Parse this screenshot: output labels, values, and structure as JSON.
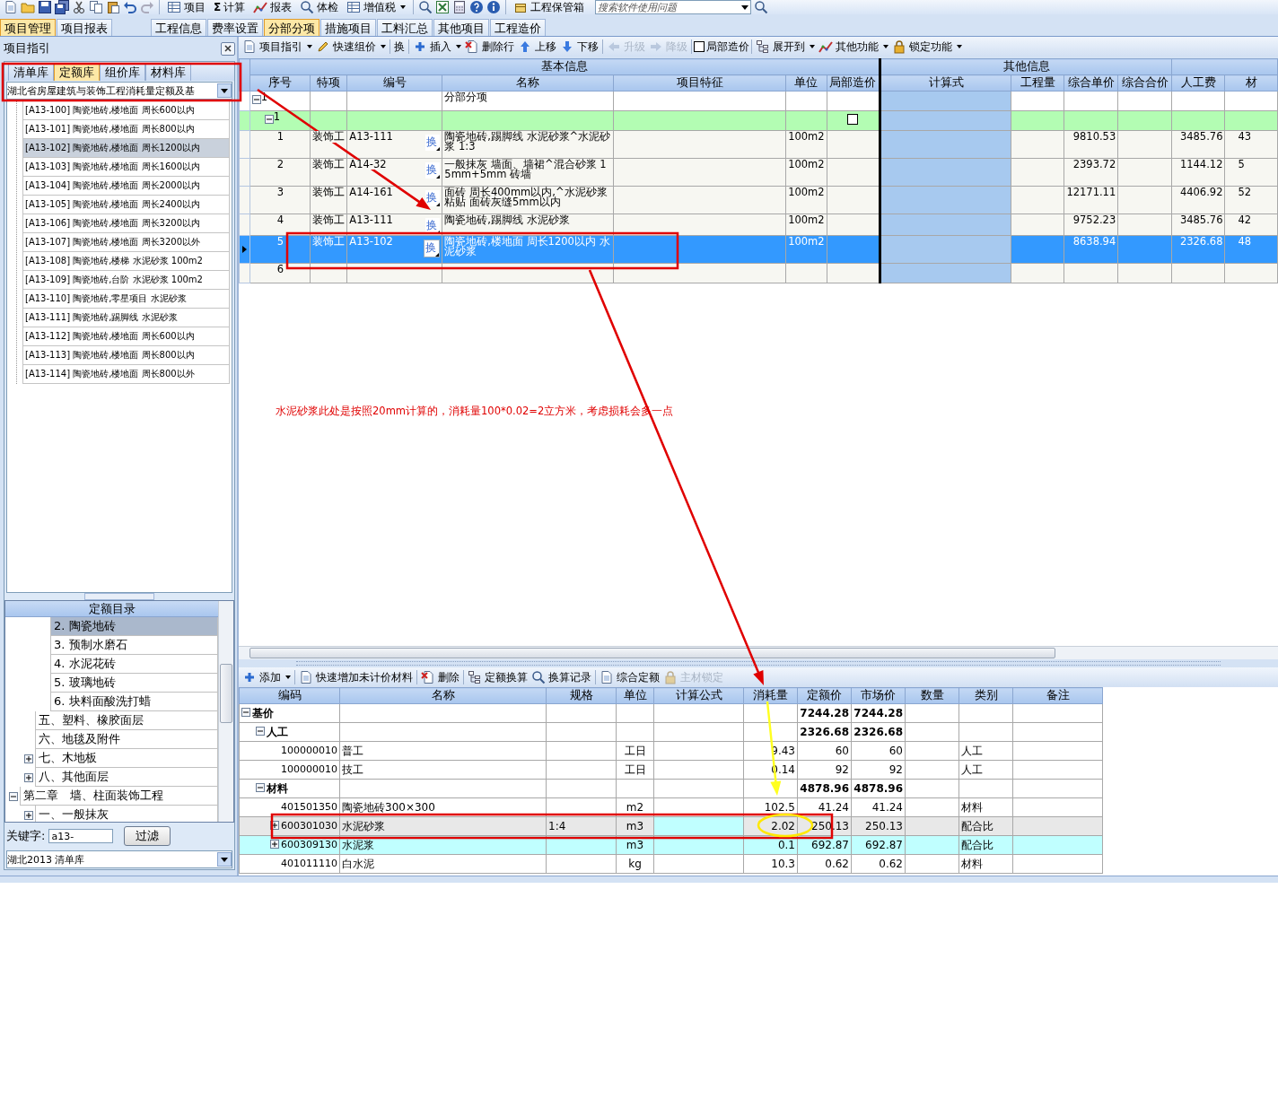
{
  "toolbar_top": {
    "commands": [
      {
        "label": "项目"
      },
      {
        "glyph": "Σ",
        "label": "计算"
      },
      {
        "label": "报表"
      },
      {
        "label": "体检"
      },
      {
        "label": "增值税",
        "dropdown": true
      }
    ],
    "storage": {
      "label": "工程保管箱"
    }
  },
  "search": {
    "placeholder": "搜索软件使用问题"
  },
  "app_tabs": [
    {
      "label": "项目管理",
      "selected": true
    },
    {
      "label": "项目报表",
      "selected": false
    }
  ],
  "view_tabs": [
    {
      "label": "工程信息",
      "selected": false
    },
    {
      "label": "费率设置",
      "selected": false
    },
    {
      "label": "分部分项",
      "selected": true
    },
    {
      "label": "措施项目",
      "selected": false
    },
    {
      "label": "工料汇总",
      "selected": false
    },
    {
      "label": "其他项目",
      "selected": false
    },
    {
      "label": "工程造价",
      "selected": false
    }
  ],
  "side_panel": {
    "title": "项目指引",
    "tabs": [
      {
        "label": "清单库",
        "selected": false
      },
      {
        "label": "定额库",
        "selected": true
      },
      {
        "label": "组价库",
        "selected": false
      },
      {
        "label": "材料库",
        "selected": false
      }
    ],
    "library": "湖北省房屋建筑与装饰工程消耗量定额及基",
    "items": [
      {
        "label": "[A13-100] 陶瓷地砖,楼地面 周长600以内",
        "selected": false
      },
      {
        "label": "[A13-101] 陶瓷地砖,楼地面 周长800以内",
        "selected": false
      },
      {
        "label": "[A13-102] 陶瓷地砖,楼地面 周长1200以内",
        "selected": true
      },
      {
        "label": "[A13-103] 陶瓷地砖,楼地面 周长1600以内",
        "selected": false
      },
      {
        "label": "[A13-104] 陶瓷地砖,楼地面 周长2000以内",
        "selected": false
      },
      {
        "label": "[A13-105] 陶瓷地砖,楼地面 周长2400以内",
        "selected": false
      },
      {
        "label": "[A13-106] 陶瓷地砖,楼地面 周长3200以内",
        "selected": false
      },
      {
        "label": "[A13-107] 陶瓷地砖,楼地面 周长3200以外",
        "selected": false
      },
      {
        "label": "[A13-108] 陶瓷地砖,楼梯 水泥砂浆 100m2",
        "selected": false
      },
      {
        "label": "[A13-109] 陶瓷地砖,台阶 水泥砂浆 100m2",
        "selected": false
      },
      {
        "label": "[A13-110] 陶瓷地砖,零星项目 水泥砂浆",
        "selected": false
      },
      {
        "label": "[A13-111] 陶瓷地砖,踢脚线 水泥砂浆",
        "selected": false
      },
      {
        "label": "[A13-112] 陶瓷地砖,楼地面 周长600以内",
        "selected": false
      },
      {
        "label": "[A13-113] 陶瓷地砖,楼地面 周长800以内",
        "selected": false
      },
      {
        "label": "[A13-114] 陶瓷地砖,楼地面 周长800以外",
        "selected": false
      }
    ],
    "catalog": {
      "title": "定额目录",
      "tree": [
        {
          "children": [
            {
              "children": [
                {
                  "label": "2. 陶瓷地砖",
                  "selected": true
                },
                {
                  "label": "3. 预制水磨石",
                  "selected": false
                },
                {
                  "label": "4. 水泥花砖",
                  "selected": false
                },
                {
                  "label": "5. 玻璃地砖",
                  "selected": false
                },
                {
                  "label": "6. 块料面酸洗打蜡",
                  "selected": false
                }
              ]
            },
            {
              "label": "五、塑料、橡胶面层",
              "selected": false
            },
            {
              "label": "六、地毯及附件",
              "selected": false
            },
            {
              "label": "七、木地板",
              "expanded": false,
              "selected": false
            },
            {
              "label": "八、其他面层",
              "expanded": false,
              "selected": false
            }
          ]
        },
        {
          "label": "第二章　墙、柱面装饰工程",
          "expanded": true,
          "selected": false,
          "children": [
            {
              "label": "一、一般抹灰",
              "expanded": false,
              "selected": false
            }
          ]
        }
      ]
    },
    "keyword": {
      "label": "关键字:",
      "value": "a13-"
    },
    "filter_button": "过滤",
    "bottom_library": "湖北2013 清单库"
  },
  "toolbar_main": [
    {
      "kind": "button",
      "label": "项目指引",
      "dropdown": true
    },
    {
      "kind": "button",
      "label": "快速组价",
      "dropdown": true
    },
    {
      "kind": "separator"
    },
    {
      "kind": "text",
      "label": "换"
    },
    {
      "kind": "separator"
    },
    {
      "kind": "button",
      "label": "插入",
      "dropdown": true
    },
    {
      "kind": "button",
      "label": "删除行"
    },
    {
      "kind": "button",
      "label": "上移"
    },
    {
      "kind": "button",
      "label": "下移"
    },
    {
      "kind": "separator"
    },
    {
      "kind": "button",
      "label": "升级",
      "disabled": true
    },
    {
      "kind": "button",
      "label": "降级",
      "disabled": true
    },
    {
      "kind": "separator"
    },
    {
      "kind": "checkbox",
      "label": "局部造价",
      "checked": false
    },
    {
      "kind": "separator"
    },
    {
      "kind": "button",
      "label": "展开到",
      "dropdown": true
    },
    {
      "kind": "button",
      "label": "其他功能",
      "dropdown": true
    },
    {
      "kind": "button",
      "label": "锁定功能",
      "dropdown": true
    }
  ],
  "grid": {
    "column_groups": [
      {
        "label": "基本信息",
        "columns": [
          "序号",
          "特项",
          "编号",
          "名称",
          "项目特征",
          "单位",
          "局部造价"
        ]
      },
      {
        "label": "其他信息",
        "columns": [
          "计算式",
          "工程量",
          "综合单价",
          "综合合价"
        ]
      },
      {
        "columns": [
          "人工费",
          "材"
        ]
      }
    ],
    "rows": [
      {
        "kind": "root",
        "seq": "1",
        "name": "分部分项",
        "expanded": true,
        "selected": false,
        "children": [
          {
            "kind": "section",
            "seq": "1",
            "expanded": true,
            "selected": false,
            "partial_cost": {
              "checked": false
            },
            "children": [
              {
                "kind": "item",
                "seq": "1",
                "special": "装饰工",
                "code": "A13-111",
                "swap": "换",
                "name": "陶瓷地砖,踢脚线 水泥砂浆^水泥砂浆 1:3",
                "unit": "100m2",
                "unit_price": "9810.53",
                "labor": "3485.76",
                "material": "43",
                "selected": false
              },
              {
                "kind": "item",
                "seq": "2",
                "special": "装饰工",
                "code": "A14-32",
                "swap": "换",
                "name": "一般抹灰 墙面、墙裙^混合砂浆 15mm+5mm 砖墙",
                "unit": "100m2",
                "unit_price": "2393.72",
                "labor": "1144.12",
                "material": "5",
                "selected": false
              },
              {
                "kind": "item",
                "seq": "3",
                "special": "装饰工",
                "code": "A14-161",
                "swap": "换",
                "name": "面砖 周长400mm以内,^水泥砂浆粘贴 面砖灰缝5mm以内",
                "unit": "100m2",
                "unit_price": "12171.11",
                "labor": "4406.92",
                "material": "52",
                "selected": false
              },
              {
                "kind": "item",
                "seq": "4",
                "special": "装饰工",
                "code": "A13-111",
                "swap": "换",
                "name": "陶瓷地砖,踢脚线 水泥砂浆",
                "unit": "100m2",
                "unit_price": "9752.23",
                "labor": "3485.76",
                "material": "42",
                "selected": false
              },
              {
                "kind": "item",
                "seq": "5",
                "special": "装饰工",
                "code": "A13-102",
                "swap": "换",
                "name": "陶瓷地砖,楼地面 周长1200以内 水泥砂浆",
                "unit": "100m2",
                "unit_price": "8638.94",
                "labor": "2326.68",
                "material": "48",
                "selected": true
              },
              {
                "kind": "item",
                "seq": "6",
                "selected": false
              }
            ]
          }
        ]
      }
    ]
  },
  "detail_toolbar": [
    {
      "kind": "button",
      "label": "添加",
      "dropdown": true
    },
    {
      "kind": "separator"
    },
    {
      "kind": "button",
      "label": "快速增加未计价材料"
    },
    {
      "kind": "separator"
    },
    {
      "kind": "button",
      "label": "删除"
    },
    {
      "kind": "separator"
    },
    {
      "kind": "button",
      "label": "定额换算"
    },
    {
      "kind": "button",
      "label": "换算记录"
    },
    {
      "kind": "separator"
    },
    {
      "kind": "button",
      "label": "综合定额"
    },
    {
      "kind": "button",
      "label": "主材锁定",
      "disabled": true
    }
  ],
  "detail_grid": {
    "columns": [
      "编码",
      "名称",
      "规格",
      "单位",
      "计算公式",
      "消耗量",
      "定额价",
      "市场价",
      "数量",
      "类别",
      "备注"
    ],
    "rows": [
      {
        "kind": "group",
        "label": "基价",
        "expanded": true,
        "quota_price": "7244.28",
        "market_price": "7244.28",
        "selected": false,
        "children": [
          {
            "kind": "group",
            "label": "人工",
            "expanded": true,
            "quota_price": "2326.68",
            "market_price": "2326.68",
            "selected": false,
            "children": [
              {
                "kind": "item",
                "code": "100000010",
                "name": "普工",
                "unit": "工日",
                "consumption": "9.43",
                "quota_price": "60",
                "market_price": "60",
                "category": "人工",
                "color": "#ffffff",
                "selected": false
              },
              {
                "kind": "item",
                "code": "100000010",
                "name": "技工",
                "unit": "工日",
                "consumption": "0.14",
                "quota_price": "92",
                "market_price": "92",
                "category": "人工",
                "color": "#ffffff",
                "selected": false
              }
            ]
          },
          {
            "kind": "group",
            "label": "材料",
            "expanded": true,
            "quota_price": "4878.96",
            "market_price": "4878.96",
            "selected": false,
            "children": [
              {
                "kind": "item",
                "code": "401501350",
                "name": "陶瓷地砖300×300",
                "unit": "m2",
                "consumption": "102.5",
                "quota_price": "41.24",
                "market_price": "41.24",
                "category": "材料",
                "color": "#ffffff",
                "selected": false
              },
              {
                "kind": "item",
                "code": "600301030",
                "name": "水泥砂浆",
                "spec": "1:4",
                "unit": "m3",
                "consumption": "2.02",
                "quota_price": "250.13",
                "market_price": "250.13",
                "category": "配合比",
                "expanded": false,
                "color": "#c0ffff",
                "selected": true
              },
              {
                "kind": "item",
                "code": "600309130",
                "name": "水泥浆",
                "unit": "m3",
                "consumption": "0.1",
                "quota_price": "692.87",
                "market_price": "692.87",
                "category": "配合比",
                "expanded": false,
                "color": "#c0ffff",
                "selected": false
              },
              {
                "kind": "item",
                "code": "401011110",
                "name": "白水泥",
                "unit": "kg",
                "consumption": "10.3",
                "quota_price": "0.62",
                "market_price": "0.62",
                "category": "材料",
                "color": "#ffffff",
                "selected": false
              }
            ]
          }
        ]
      }
    ]
  },
  "annotation": {
    "note": "水泥砂浆此处是按照20mm计算的，消耗量100*0.02=2立方米，考虑损耗会多一点"
  }
}
